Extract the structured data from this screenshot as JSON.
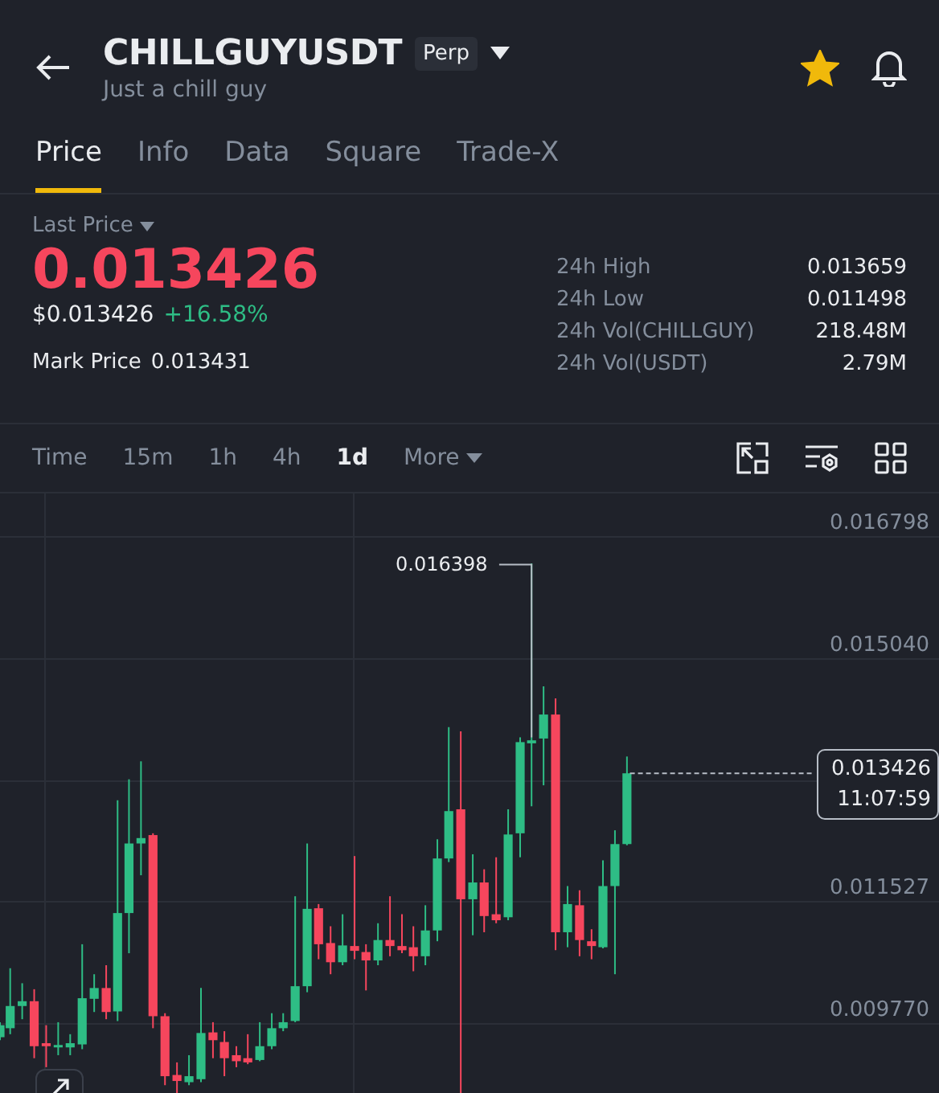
{
  "header": {
    "symbol": "CHILLGUYUSDT",
    "badge": "Perp",
    "subtitle": "Just a chill guy",
    "favorite": true
  },
  "tabs": [
    {
      "label": "Price",
      "selected": true
    },
    {
      "label": "Info",
      "selected": false
    },
    {
      "label": "Data",
      "selected": false
    },
    {
      "label": "Square",
      "selected": false
    },
    {
      "label": "Trade-X",
      "selected": false
    }
  ],
  "ticker": {
    "last_price_label": "Last Price",
    "last_price": "0.013426",
    "usd_price": "$0.013426",
    "change": "+16.58%",
    "mark_label": "Mark Price",
    "mark_value": "0.013431",
    "stats": [
      {
        "label": "24h High",
        "value": "0.013659"
      },
      {
        "label": "24h Low",
        "value": "0.011498"
      },
      {
        "label": "24h Vol(CHILLGUY)",
        "value": "218.48M"
      },
      {
        "label": "24h Vol(USDT)",
        "value": "2.79M"
      }
    ]
  },
  "intervals": [
    {
      "label": "Time",
      "kind": "plain",
      "selected": false
    },
    {
      "label": "15m",
      "kind": "plain",
      "selected": false
    },
    {
      "label": "1h",
      "kind": "plain",
      "selected": false
    },
    {
      "label": "4h",
      "kind": "plain",
      "selected": false
    },
    {
      "label": "1d",
      "kind": "plain",
      "selected": true
    },
    {
      "label": "More",
      "kind": "menu",
      "selected": false
    }
  ],
  "chart": {
    "y_labels": [
      "0.016798",
      "0.015040",
      "0.011527",
      "0.009770"
    ],
    "high_marker": "0.016398",
    "last_price": "0.013426",
    "countdown": "11:07:59"
  }
}
